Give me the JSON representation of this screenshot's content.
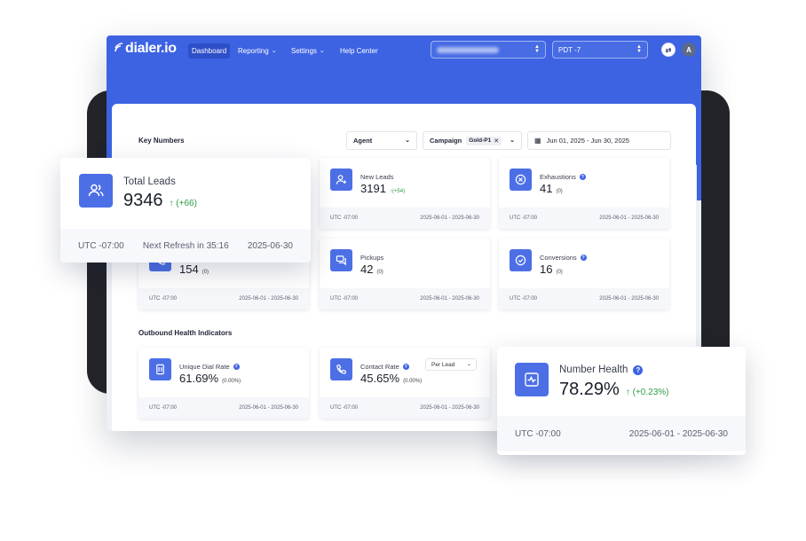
{
  "brand": {
    "name": "dialer.io"
  },
  "nav": {
    "items": [
      {
        "label": "Dashboard",
        "active": true,
        "has_menu": false
      },
      {
        "label": "Reporting",
        "active": false,
        "has_menu": true
      },
      {
        "label": "Settings",
        "active": false,
        "has_menu": true
      },
      {
        "label": "Help Center",
        "active": false,
        "has_menu": false
      }
    ],
    "timezone": "PDT -7",
    "avatar_initial": "A"
  },
  "key_numbers": {
    "title": "Key Numbers",
    "filters": {
      "agent_label": "Agent",
      "campaign_label": "Campaign",
      "campaign_chip": "Gold-P1",
      "date_range": "Jun 01, 2025 - Jun 30, 2025"
    },
    "cards": {
      "new_leads": {
        "title": "New Leads",
        "value": "3191",
        "delta": "(+54)",
        "tz": "UTC -07:00",
        "range": "2025-06-01 - 2025-06-30"
      },
      "exhaustions": {
        "title": "Exhaustions",
        "value": "41",
        "delta": "(0)",
        "tz": "UTC -07:00",
        "range": "2025-06-01 - 2025-06-30"
      },
      "hidden_card": {
        "value": "154",
        "delta": "(0)",
        "tz": "UTC -07:00",
        "range": "2025-06-01 - 2025-06-30"
      },
      "pickups": {
        "title": "Pickups",
        "value": "42",
        "delta": "(0)",
        "tz": "UTC -07:00",
        "range": "2025-06-01 - 2025-06-30"
      },
      "conversions": {
        "title": "Conversions",
        "value": "16",
        "delta": "(0)",
        "tz": "UTC -07:00",
        "range": "2025-06-01 - 2025-06-30"
      }
    }
  },
  "outbound": {
    "title": "Outbound Health Indicators",
    "cards": {
      "unique_dial_rate": {
        "title": "Unique Dial Rate",
        "value": "61.69%",
        "delta": "(0.00%)",
        "tz": "UTC -07:00",
        "range": "2025-06-01 - 2025-06-30"
      },
      "contact_rate": {
        "title": "Contact Rate",
        "value": "45.65%",
        "delta": "(0.00%)",
        "select": "Per Lead",
        "tz": "UTC -07:00",
        "range": "2025-06-01 - 2025-06-30"
      }
    }
  },
  "total_leads": {
    "title": "Total Leads",
    "value": "9346",
    "delta": "(+66)",
    "tz": "UTC -07:00",
    "refresh": "Next Refresh in 35:16",
    "date": "2025-06-30"
  },
  "number_health": {
    "title": "Number Health",
    "value": "78.29%",
    "delta": "(+0.23%)",
    "tz": "UTC -07:00",
    "range": "2025-06-01 - 2025-06-30"
  },
  "icons": {
    "users": "users-icon",
    "user_plus": "user-plus-icon",
    "x_circle": "x-circle-icon",
    "chat": "chat-icon",
    "check_circle": "check-circle-icon",
    "sim": "sim-card-icon",
    "phone": "phone-icon",
    "pulse": "pulse-icon"
  },
  "colors": {
    "primary": "#3d63e3",
    "icon_tile": "#4c6fe6",
    "positive": "#2e9a45"
  }
}
